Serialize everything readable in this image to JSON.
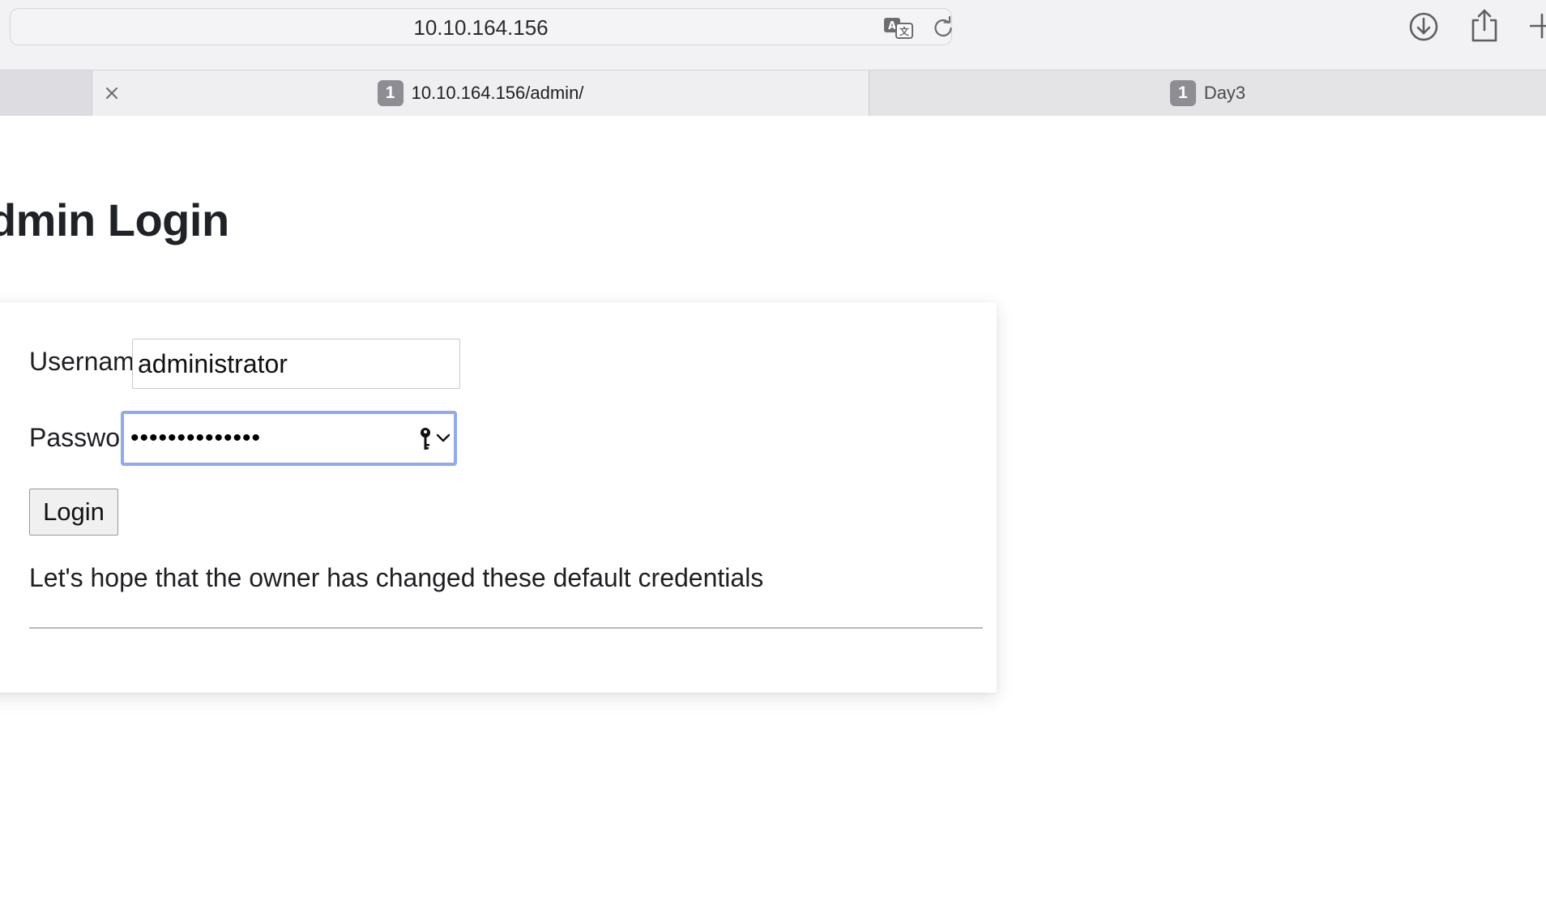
{
  "browser": {
    "address": "10.10.164.156",
    "tabs": [
      {
        "badge": "1",
        "title": "10.10.164.156/admin/",
        "active": true
      },
      {
        "badge": "1",
        "title": "Day3",
        "active": false
      }
    ],
    "icons": [
      "translate-icon",
      "reload-icon",
      "download-icon",
      "share-icon",
      "plus-icon",
      "close-icon"
    ]
  },
  "page": {
    "title": "Admin Login",
    "form": {
      "username_label": "Username",
      "username_value": "administrator",
      "password_label": "Password",
      "password_mask": "••••••••••••••",
      "submit_label": "Login"
    },
    "hint": "Let's hope that the owner has changed these default credentials"
  },
  "colors": {
    "focus_ring": "#8eaaf0",
    "tab_badge": "#8e8d94",
    "toolbar_bg": "#f2f1f3"
  }
}
